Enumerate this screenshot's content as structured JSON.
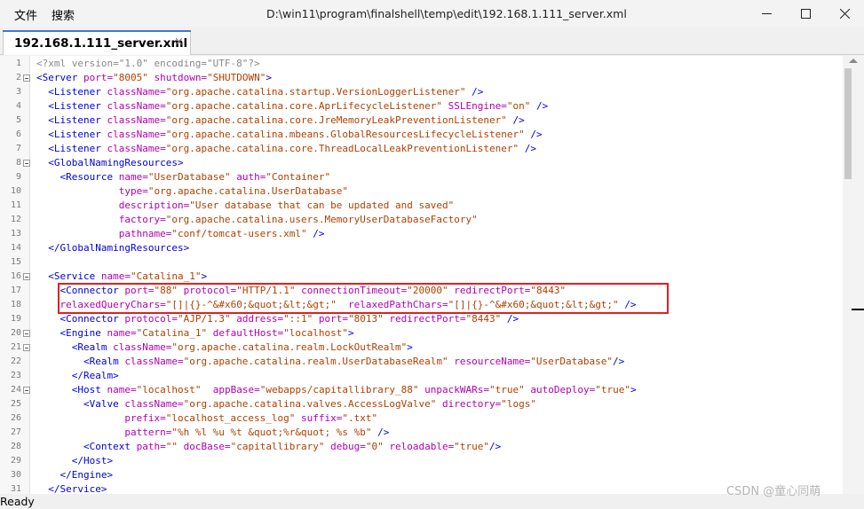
{
  "menu": {
    "file": "文件",
    "search": "搜索"
  },
  "window": {
    "title": "D:\\win11\\program\\finalshell\\temp\\edit\\192.168.1.111_server.xml"
  },
  "tab": {
    "label": "192.168.1.111_server.xml",
    "close": "×"
  },
  "status": {
    "text": "Ready"
  },
  "watermark": "CSDN @童心同萌",
  "colors": {
    "tag": "#0000e0",
    "attr": "#b000b0",
    "value": "#b04000",
    "highlight_box": "#e02020",
    "tab_accent": "#3c78d8"
  },
  "lines": [
    {
      "n": "1",
      "fold": false,
      "tokens": [
        [
          "pi",
          "<?xml version=\"1.0\" encoding=\"UTF-8\"?>"
        ]
      ]
    },
    {
      "n": "2",
      "fold": true,
      "tokens": [
        [
          "tag",
          "<Server "
        ],
        [
          "attr",
          "port="
        ],
        [
          "val",
          "\"8005\""
        ],
        [
          "attr",
          " shutdown="
        ],
        [
          "val",
          "\"SHUTDOWN\""
        ],
        [
          "tag",
          ">"
        ]
      ]
    },
    {
      "n": "3",
      "fold": false,
      "tokens": [
        [
          "plain",
          "  "
        ],
        [
          "tag",
          "<Listener "
        ],
        [
          "attr",
          "className="
        ],
        [
          "val",
          "\"org.apache.catalina.startup.VersionLoggerListener\""
        ],
        [
          "tag",
          " />"
        ]
      ]
    },
    {
      "n": "4",
      "fold": false,
      "tokens": [
        [
          "plain",
          "  "
        ],
        [
          "tag",
          "<Listener "
        ],
        [
          "attr",
          "className="
        ],
        [
          "val",
          "\"org.apache.catalina.core.AprLifecycleListener\""
        ],
        [
          "attr",
          " SSLEngine="
        ],
        [
          "val",
          "\"on\""
        ],
        [
          "tag",
          " />"
        ]
      ]
    },
    {
      "n": "5",
      "fold": false,
      "tokens": [
        [
          "plain",
          "  "
        ],
        [
          "tag",
          "<Listener "
        ],
        [
          "attr",
          "className="
        ],
        [
          "val",
          "\"org.apache.catalina.core.JreMemoryLeakPreventionListener\""
        ],
        [
          "tag",
          " />"
        ]
      ]
    },
    {
      "n": "6",
      "fold": false,
      "tokens": [
        [
          "plain",
          "  "
        ],
        [
          "tag",
          "<Listener "
        ],
        [
          "attr",
          "className="
        ],
        [
          "val",
          "\"org.apache.catalina.mbeans.GlobalResourcesLifecycleListener\""
        ],
        [
          "tag",
          " />"
        ]
      ]
    },
    {
      "n": "7",
      "fold": false,
      "tokens": [
        [
          "plain",
          "  "
        ],
        [
          "tag",
          "<Listener "
        ],
        [
          "attr",
          "className="
        ],
        [
          "val",
          "\"org.apache.catalina.core.ThreadLocalLeakPreventionListener\""
        ],
        [
          "tag",
          " />"
        ]
      ]
    },
    {
      "n": "8",
      "fold": true,
      "tokens": [
        [
          "plain",
          "  "
        ],
        [
          "tag",
          "<GlobalNamingResources>"
        ]
      ]
    },
    {
      "n": "9",
      "fold": false,
      "tokens": [
        [
          "plain",
          "    "
        ],
        [
          "tag",
          "<Resource "
        ],
        [
          "attr",
          "name="
        ],
        [
          "val",
          "\"UserDatabase\""
        ],
        [
          "attr",
          " auth="
        ],
        [
          "val",
          "\"Container\""
        ]
      ]
    },
    {
      "n": "10",
      "fold": false,
      "tokens": [
        [
          "plain",
          "              "
        ],
        [
          "attr",
          "type="
        ],
        [
          "val",
          "\"org.apache.catalina.UserDatabase\""
        ]
      ]
    },
    {
      "n": "11",
      "fold": false,
      "tokens": [
        [
          "plain",
          "              "
        ],
        [
          "attr",
          "description="
        ],
        [
          "val",
          "\"User database that can be updated and saved\""
        ]
      ]
    },
    {
      "n": "12",
      "fold": false,
      "tokens": [
        [
          "plain",
          "              "
        ],
        [
          "attr",
          "factory="
        ],
        [
          "val",
          "\"org.apache.catalina.users.MemoryUserDatabaseFactory\""
        ]
      ]
    },
    {
      "n": "13",
      "fold": false,
      "tokens": [
        [
          "plain",
          "              "
        ],
        [
          "attr",
          "pathname="
        ],
        [
          "val",
          "\"conf/tomcat-users.xml\""
        ],
        [
          "tag",
          " />"
        ]
      ]
    },
    {
      "n": "14",
      "fold": false,
      "tokens": [
        [
          "plain",
          "  "
        ],
        [
          "tag",
          "</GlobalNamingResources>"
        ]
      ]
    },
    {
      "n": "15",
      "fold": false,
      "tokens": []
    },
    {
      "n": "16",
      "fold": true,
      "tokens": [
        [
          "plain",
          "  "
        ],
        [
          "tag",
          "<Service "
        ],
        [
          "attr",
          "name="
        ],
        [
          "val",
          "\"Catalina_1\""
        ],
        [
          "tag",
          ">"
        ]
      ]
    },
    {
      "n": "17",
      "fold": false,
      "tokens": [
        [
          "plain",
          "    "
        ],
        [
          "tag",
          "<Connector "
        ],
        [
          "attr",
          "port="
        ],
        [
          "val",
          "\"88\""
        ],
        [
          "attr",
          " protocol="
        ],
        [
          "val",
          "\"HTTP/1.1\""
        ],
        [
          "attr",
          " connectionTimeout="
        ],
        [
          "val",
          "\"20000\""
        ],
        [
          "attr",
          " redirectPort="
        ],
        [
          "val",
          "\"8443\""
        ]
      ]
    },
    {
      "n": "18",
      "fold": false,
      "tokens": [
        [
          "plain",
          "    "
        ],
        [
          "attr",
          "relaxedQueryChars="
        ],
        [
          "val",
          "\"[]|{}-^&#x60;&quot;&lt;&gt;\""
        ],
        [
          "attr",
          "  relaxedPathChars="
        ],
        [
          "val",
          "\"[]|{}-^&#x60;&quot;&lt;&gt;\""
        ],
        [
          "tag",
          " />"
        ]
      ]
    },
    {
      "n": "19",
      "fold": false,
      "tokens": [
        [
          "plain",
          "    "
        ],
        [
          "tag",
          "<Connector "
        ],
        [
          "attr",
          "protocol="
        ],
        [
          "val",
          "\"AJP/1.3\""
        ],
        [
          "attr",
          " address="
        ],
        [
          "val",
          "\"::1\""
        ],
        [
          "attr",
          " port="
        ],
        [
          "val",
          "\"8013\""
        ],
        [
          "attr",
          " redirectPort="
        ],
        [
          "val",
          "\"8443\""
        ],
        [
          "tag",
          " />"
        ]
      ]
    },
    {
      "n": "20",
      "fold": true,
      "tokens": [
        [
          "plain",
          "    "
        ],
        [
          "tag",
          "<Engine "
        ],
        [
          "attr",
          "name="
        ],
        [
          "val",
          "\"Catalina_1\""
        ],
        [
          "attr",
          " defaultHost="
        ],
        [
          "val",
          "\"localhost\""
        ],
        [
          "tag",
          ">"
        ]
      ]
    },
    {
      "n": "21",
      "fold": true,
      "tokens": [
        [
          "plain",
          "      "
        ],
        [
          "tag",
          "<Realm "
        ],
        [
          "attr",
          "className="
        ],
        [
          "val",
          "\"org.apache.catalina.realm.LockOutRealm\""
        ],
        [
          "tag",
          ">"
        ]
      ]
    },
    {
      "n": "22",
      "fold": false,
      "tokens": [
        [
          "plain",
          "        "
        ],
        [
          "tag",
          "<Realm "
        ],
        [
          "attr",
          "className="
        ],
        [
          "val",
          "\"org.apache.catalina.realm.UserDatabaseRealm\""
        ],
        [
          "attr",
          " resourceName="
        ],
        [
          "val",
          "\"UserDatabase\""
        ],
        [
          "tag",
          "/>"
        ]
      ]
    },
    {
      "n": "23",
      "fold": false,
      "tokens": [
        [
          "plain",
          "      "
        ],
        [
          "tag",
          "</Realm>"
        ]
      ]
    },
    {
      "n": "24",
      "fold": true,
      "tokens": [
        [
          "plain",
          "      "
        ],
        [
          "tag",
          "<Host "
        ],
        [
          "attr",
          "name="
        ],
        [
          "val",
          "\"localhost\""
        ],
        [
          "attr",
          "  appBase="
        ],
        [
          "val",
          "\"webapps/capitallibrary_88\""
        ],
        [
          "attr",
          " unpackWARs="
        ],
        [
          "val",
          "\"true\""
        ],
        [
          "attr",
          " autoDeploy="
        ],
        [
          "val",
          "\"true\""
        ],
        [
          "tag",
          ">"
        ]
      ]
    },
    {
      "n": "25",
      "fold": false,
      "tokens": [
        [
          "plain",
          "        "
        ],
        [
          "tag",
          "<Valve "
        ],
        [
          "attr",
          "className="
        ],
        [
          "val",
          "\"org.apache.catalina.valves.AccessLogValve\""
        ],
        [
          "attr",
          " directory="
        ],
        [
          "val",
          "\"logs\""
        ]
      ]
    },
    {
      "n": "26",
      "fold": false,
      "tokens": [
        [
          "plain",
          "               "
        ],
        [
          "attr",
          "prefix="
        ],
        [
          "val",
          "\"localhost_access_log\""
        ],
        [
          "attr",
          " suffix="
        ],
        [
          "val",
          "\".txt\""
        ]
      ]
    },
    {
      "n": "27",
      "fold": false,
      "tokens": [
        [
          "plain",
          "               "
        ],
        [
          "attr",
          "pattern="
        ],
        [
          "val",
          "\"%h %l %u %t &quot;%r&quot; %s %b\""
        ],
        [
          "tag",
          " />"
        ]
      ]
    },
    {
      "n": "28",
      "fold": false,
      "tokens": [
        [
          "plain",
          "        "
        ],
        [
          "tag",
          "<Context "
        ],
        [
          "attr",
          "path="
        ],
        [
          "val",
          "\"\""
        ],
        [
          "attr",
          " docBase="
        ],
        [
          "val",
          "\"capitallibrary\""
        ],
        [
          "attr",
          " debug="
        ],
        [
          "val",
          "\"0\""
        ],
        [
          "attr",
          " reloadable="
        ],
        [
          "val",
          "\"true\""
        ],
        [
          "tag",
          "/>"
        ]
      ]
    },
    {
      "n": "29",
      "fold": false,
      "tokens": [
        [
          "plain",
          "      "
        ],
        [
          "tag",
          "</Host>"
        ]
      ]
    },
    {
      "n": "30",
      "fold": false,
      "tokens": [
        [
          "plain",
          "    "
        ],
        [
          "tag",
          "</Engine>"
        ]
      ]
    },
    {
      "n": "31",
      "fold": false,
      "tokens": [
        [
          "plain",
          "  "
        ],
        [
          "tag",
          "</Service>"
        ]
      ]
    }
  ]
}
